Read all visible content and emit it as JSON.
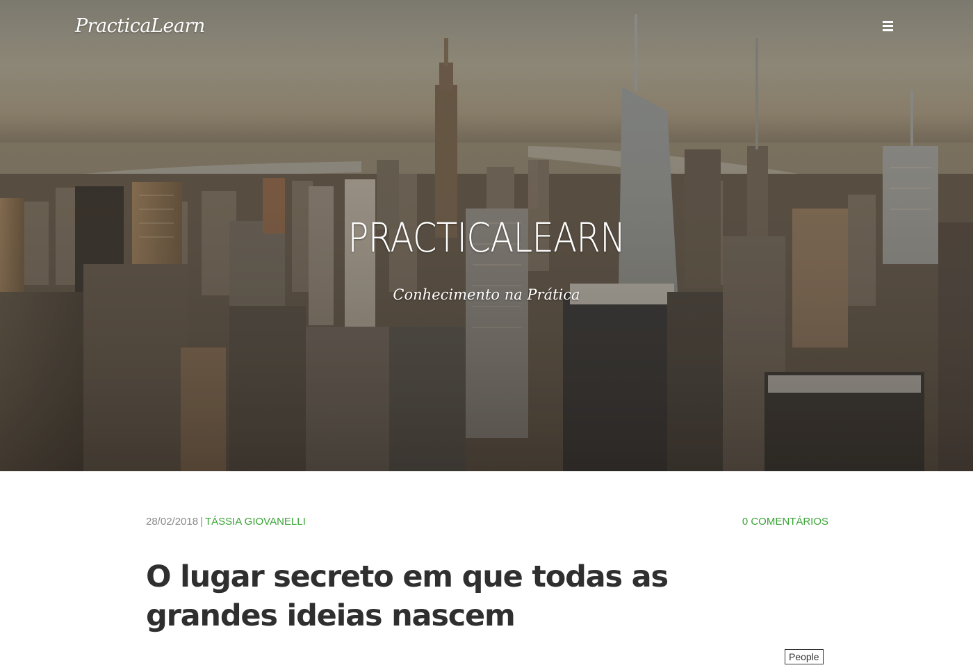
{
  "header": {
    "brand": "PracticaLearn",
    "menu_icon": "hamburger-icon"
  },
  "hero": {
    "title": "PRACTICALEARN",
    "subtitle": "Conhecimento na Prática"
  },
  "post": {
    "date": "28/02/2018",
    "separator": "|",
    "author": "TÁSSIA GIOVANELLI",
    "comments": "0 COMENTÁRIOS",
    "title": "O lugar secreto em que todas as grandes ideias nascem",
    "image_tag": "People"
  },
  "colors": {
    "accent": "#3aa335",
    "title_text": "#2f2f2f",
    "meta_text": "#8a8a8a"
  }
}
